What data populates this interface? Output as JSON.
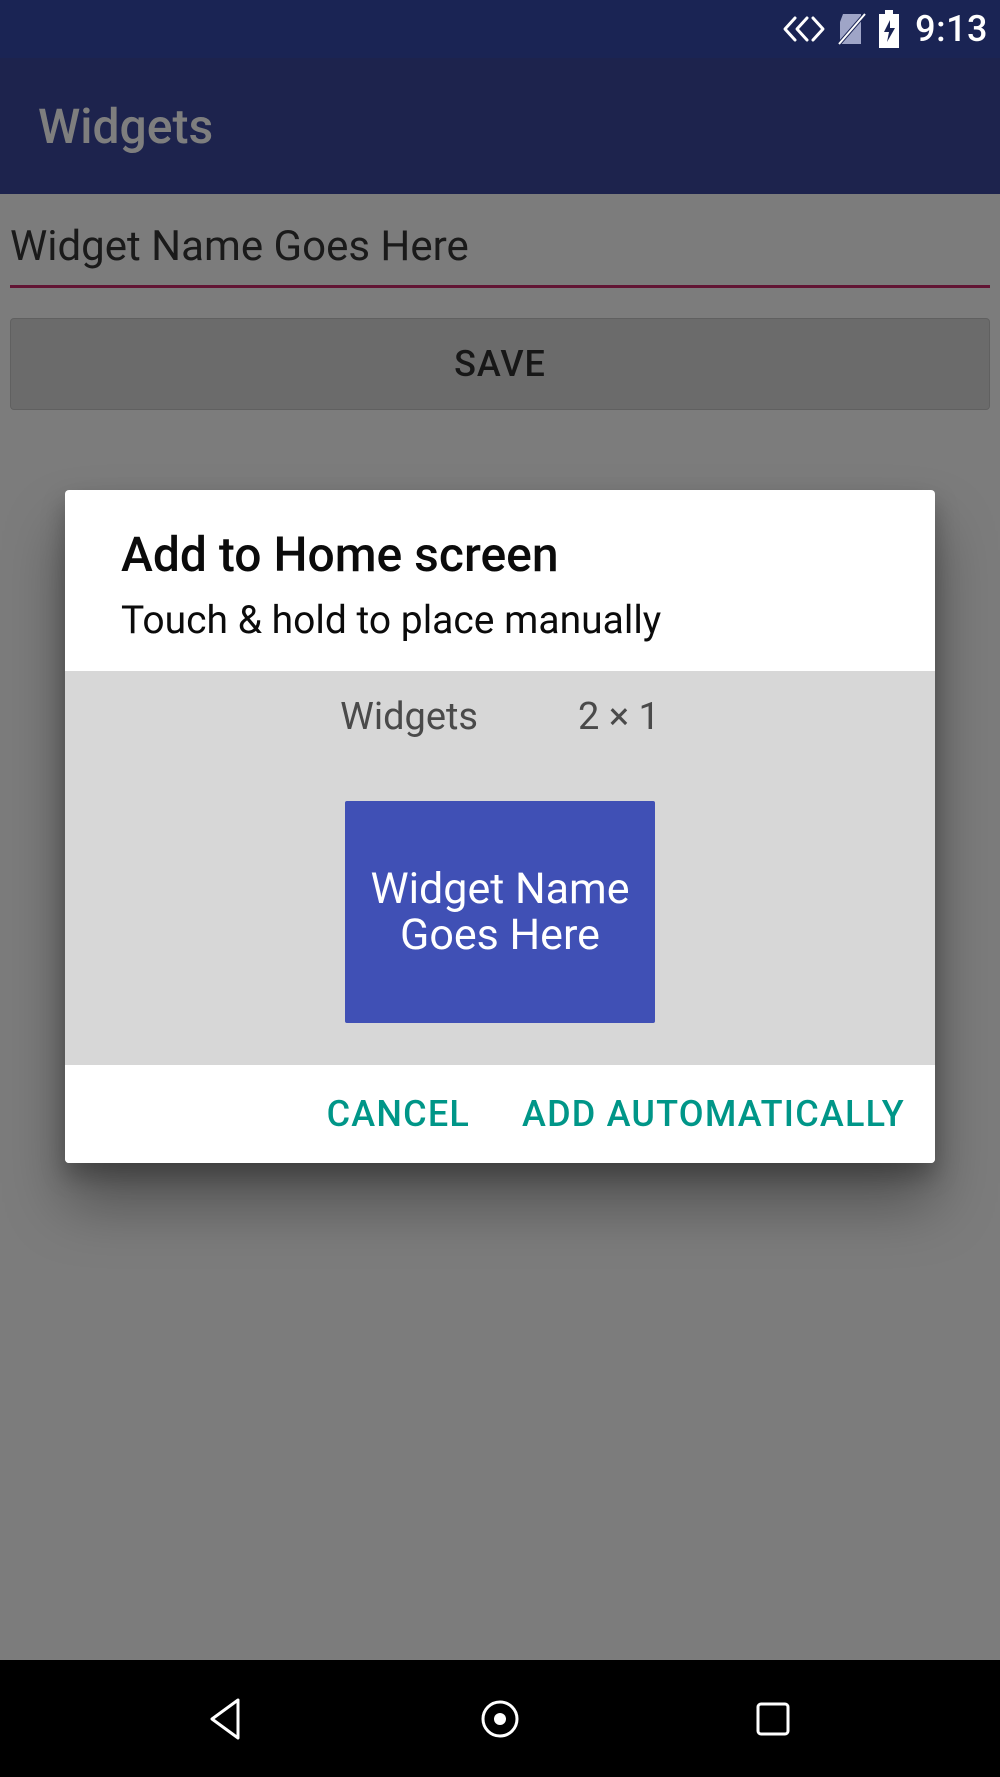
{
  "status_bar": {
    "time": "9:13"
  },
  "app_bar": {
    "title": "Widgets"
  },
  "content": {
    "widget_name_placeholder": "Widget Name Goes Here",
    "save_label": "SAVE"
  },
  "dialog": {
    "title": "Add to Home screen",
    "subtitle": "Touch & hold to place manually",
    "preview": {
      "label": "Widgets",
      "size": "2 × 1",
      "widget_text": "Widget Name Goes Here"
    },
    "actions": {
      "cancel": "CANCEL",
      "add": "ADD AUTOMATICALLY"
    }
  },
  "colors": {
    "primary": "#283593",
    "primary_dark": "#1a2454",
    "accent_underline": "#c2185b",
    "teal": "#009688",
    "widget_bg": "#4050b5"
  }
}
